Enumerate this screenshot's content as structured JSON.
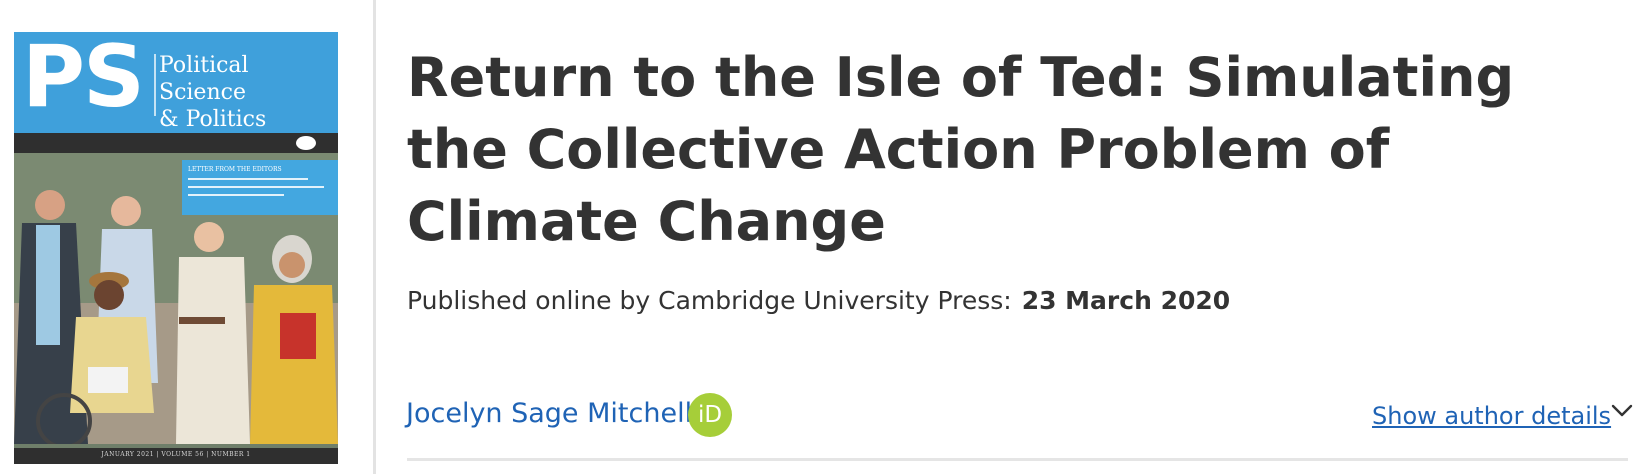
{
  "cover": {
    "logo": "PS",
    "journal_line1": "Political Science",
    "journal_line2": "& Politics",
    "band_title": "LETTER FROM THE EDITORS",
    "footer": "JANUARY 2021 | VOLUME 56 | NUMBER 1"
  },
  "article": {
    "title": "Return to the Isle of Ted: Simulating the Collective Action Problem of Climate Change",
    "published_label": "Published online by Cambridge University Press:",
    "published_date": "23 March 2020"
  },
  "authors": {
    "name": "Jocelyn Sage Mitchell",
    "orcid_label": "iD",
    "show_details_label": "Show author details"
  },
  "icons": {
    "orcid": "orcid-icon",
    "chevron": "chevron-down-icon"
  },
  "colors": {
    "link": "#1f63b5",
    "orcid": "#a6ce39",
    "cover_blue": "#3fa0db",
    "text": "#333333"
  }
}
